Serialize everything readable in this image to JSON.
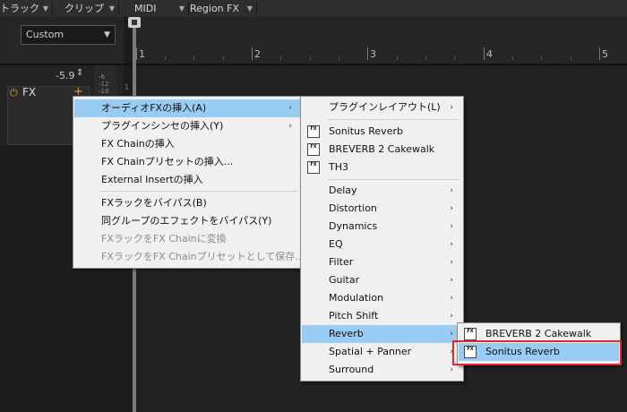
{
  "topbar": {
    "items": [
      {
        "label": "トラック"
      },
      {
        "label": "クリップ"
      },
      {
        "label": "MIDI"
      },
      {
        "label": "Region FX"
      }
    ]
  },
  "preset": {
    "value": "Custom"
  },
  "ruler": {
    "labels": [
      "1",
      "2",
      "3",
      "4",
      "5"
    ]
  },
  "track": {
    "volume": "-5.9",
    "meter_labels": [
      "-6",
      "-12",
      "-18"
    ],
    "fx_label": "FX",
    "lane_marker": "1"
  },
  "menu1": {
    "items": [
      {
        "label": "オーディオFXの挿入(A)",
        "highlighted": true,
        "submenu": true
      },
      {
        "label": "プラグインシンセの挿入(Y)",
        "submenu": true
      },
      {
        "label": "FX Chainの挿入"
      },
      {
        "label": "FX Chainプリセットの挿入..."
      },
      {
        "label": "External Insertの挿入"
      },
      {
        "label": "FXラックをバイパス(B)"
      },
      {
        "label": "同グループのエフェクトをバイパス(Y)"
      },
      {
        "label": "FXラックをFX Chainに変換",
        "disabled": true
      },
      {
        "label": "FXラックをFX Chainプリセットとして保存...",
        "disabled": true
      }
    ]
  },
  "menu2": {
    "items": [
      {
        "label": "プラグインレイアウト(L)",
        "submenu": true
      },
      {
        "label": "Sonitus Reverb",
        "icon": "fx-plugin-icon"
      },
      {
        "label": "BREVERB 2 Cakewalk",
        "icon": "fx-plugin-icon"
      },
      {
        "label": "TH3",
        "icon": "fx-plugin-icon"
      },
      {
        "label": "Delay",
        "submenu": true
      },
      {
        "label": "Distortion",
        "submenu": true
      },
      {
        "label": "Dynamics",
        "submenu": true
      },
      {
        "label": "EQ",
        "submenu": true
      },
      {
        "label": "Filter",
        "submenu": true
      },
      {
        "label": "Guitar",
        "submenu": true
      },
      {
        "label": "Modulation",
        "submenu": true
      },
      {
        "label": "Pitch Shift",
        "submenu": true
      },
      {
        "label": "Reverb",
        "submenu": true,
        "highlighted": true
      },
      {
        "label": "Spatial + Panner",
        "submenu": true
      },
      {
        "label": "Surround",
        "submenu": true
      }
    ]
  },
  "menu3": {
    "items": [
      {
        "label": "BREVERB 2 Cakewalk",
        "icon": "fx-plugin-icon"
      },
      {
        "label": "Sonitus Reverb",
        "icon": "fx-plugin-icon",
        "highlighted": true
      }
    ]
  },
  "icons": {
    "fx_glyph": "FX",
    "submenu_arrow": "›",
    "power": "⏻",
    "dropdown": "▼",
    "volume_arrows": "⇕"
  },
  "colors": {
    "highlight": "#99ccf3",
    "callout": "#e2262a",
    "accent": "#e69a2a"
  }
}
